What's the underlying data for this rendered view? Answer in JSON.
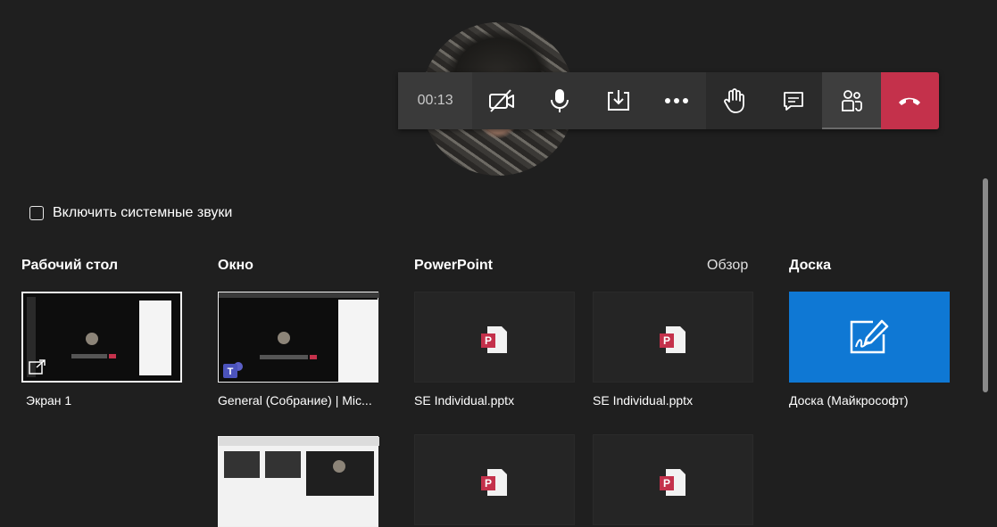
{
  "call": {
    "timer": "00:13",
    "buttons": [
      {
        "name": "camera-off-button",
        "icon": "camera-off-icon"
      },
      {
        "name": "microphone-button",
        "icon": "microphone-icon"
      },
      {
        "name": "share-button",
        "icon": "share-tray-icon"
      },
      {
        "name": "more-actions-button",
        "icon": "more-icon"
      },
      {
        "name": "raise-hand-button",
        "icon": "hand-icon"
      },
      {
        "name": "chat-button",
        "icon": "chat-icon"
      },
      {
        "name": "participants-button",
        "icon": "participants-icon"
      },
      {
        "name": "hang-up-button",
        "icon": "hang-up-icon"
      }
    ],
    "colors": {
      "hangup": "#c4314b",
      "toolbar": "#2d2d2d"
    }
  },
  "share": {
    "system_audio_label": "Включить системные звуки",
    "sections": {
      "desktop": "Рабочий стол",
      "window": "Окно",
      "powerpoint": "PowerPoint",
      "browse": "Обзор",
      "whiteboard": "Доска"
    },
    "tiles": {
      "screen1": "Экран 1",
      "window1": "General (Собрание) | Mic...",
      "ppt1": "SE Individual.pptx",
      "ppt2": "SE Individual.pptx",
      "whiteboard1": "Доска (Майкрософт)"
    },
    "colors": {
      "whiteboard": "#0f78d4",
      "ppt_red": "#c4314b"
    }
  }
}
